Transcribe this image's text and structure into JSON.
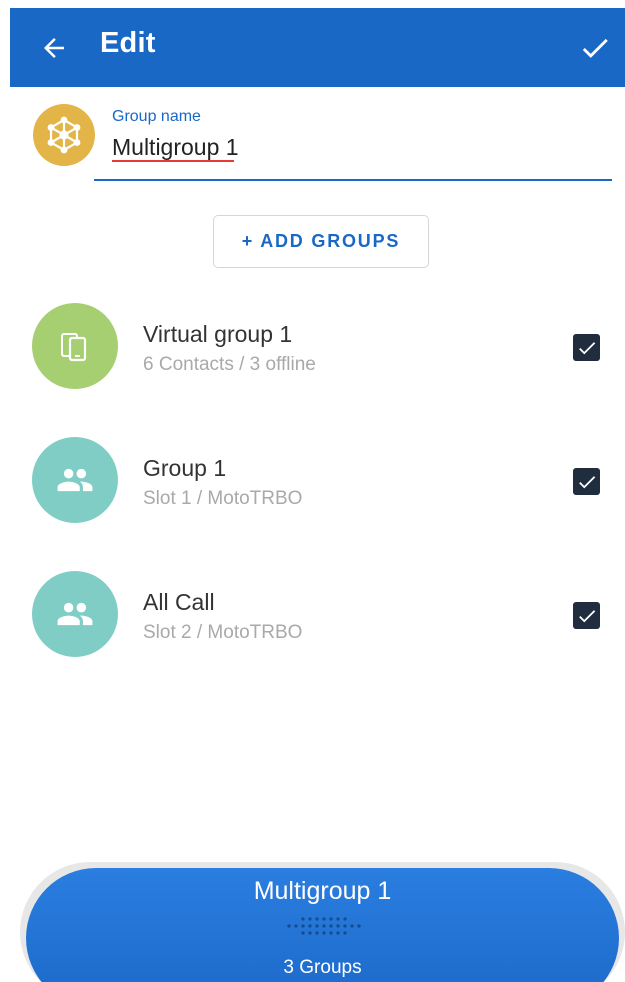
{
  "header": {
    "title": "Edit",
    "back_icon": "arrow-left-icon",
    "confirm_icon": "check-icon",
    "background": "#1a68c6"
  },
  "group_form": {
    "avatar_icon": "network-hub-icon",
    "avatar_color": "#e3b548",
    "label": "Group name",
    "value": "Multigroup 1"
  },
  "add_groups_label": "+ ADD GROUPS",
  "groups": [
    {
      "title": "Virtual group 1",
      "subtitle": "6 Contacts / 3 offline",
      "icon": "devices-icon",
      "color": "#a6cf71",
      "checked": true
    },
    {
      "title": "Group 1",
      "subtitle": "Slot 1 / MotoTRBO",
      "icon": "people-icon",
      "color": "#80cdc6",
      "checked": true
    },
    {
      "title": "All Call",
      "subtitle": "Slot 2 / MotoTRBO",
      "icon": "people-icon",
      "color": "#80cdc6",
      "checked": true
    }
  ],
  "ptt": {
    "name": "Multigroup 1",
    "count": "3 Groups",
    "grip_icon": "grip-dots-icon"
  }
}
